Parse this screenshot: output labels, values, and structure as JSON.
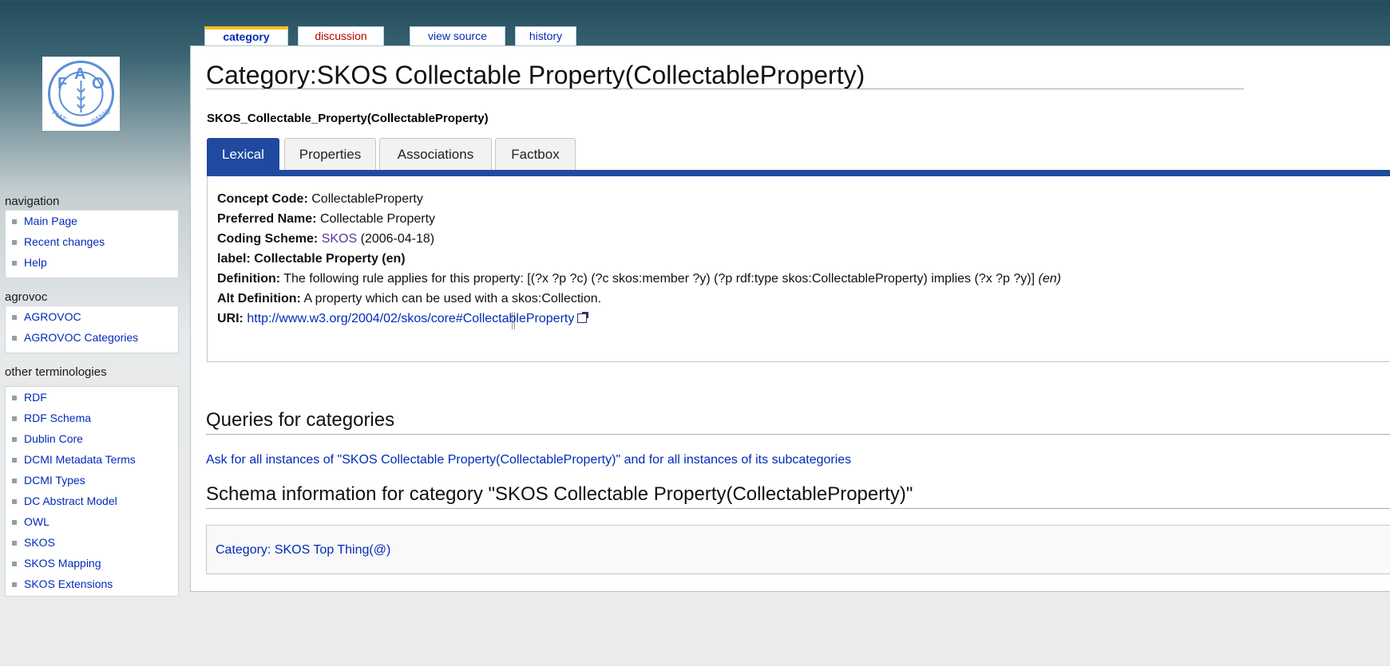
{
  "page_tabs": {
    "category": "category",
    "discussion": "discussion",
    "view_source": "view source",
    "history": "history"
  },
  "logo": {
    "alt": "FAO FIAT PANIS"
  },
  "sidebar": {
    "navigation": {
      "title": "navigation",
      "items": [
        "Main Page",
        "Recent changes",
        "Help"
      ]
    },
    "agrovoc": {
      "title": "agrovoc",
      "items": [
        "AGROVOC",
        "AGROVOC Categories"
      ]
    },
    "other": {
      "title": "other terminologies",
      "items": [
        "RDF",
        "RDF Schema",
        "Dublin Core",
        "DCMI Metadata Terms",
        "DCMI Types",
        "DC Abstract Model",
        "OWL",
        "SKOS",
        "SKOS Mapping",
        "SKOS Extensions"
      ]
    }
  },
  "main": {
    "title": "Category:SKOS Collectable Property(CollectableProperty)",
    "subheading": "SKOS_Collectable_Property(CollectableProperty)",
    "tabs": [
      "Lexical",
      "Properties",
      "Associations",
      "Factbox"
    ],
    "lexical": {
      "concept_code_label": "Concept Code:",
      "concept_code_value": "CollectableProperty",
      "preferred_name_label": "Preferred Name:",
      "preferred_name_value": "Collectable Property",
      "coding_scheme_label": "Coding Scheme:",
      "coding_scheme_link": "SKOS",
      "coding_scheme_date": "(2006-04-18)",
      "label_label": "label:",
      "label_value": "Collectable Property (en)",
      "definition_label": "Definition:",
      "definition_value": "The following rule applies for this property: [(?x ?p ?c) (?c skos:member ?y) (?p rdf:type skos:CollectableProperty) implies (?x ?p ?y)]",
      "definition_lang": "(en)",
      "alt_definition_label": "Alt Definition:",
      "alt_definition_value": "A property which can be used with a skos:Collection.",
      "uri_label": "URI:",
      "uri_value": "http://www.w3.org/2004/02/skos/core#CollectableProperty"
    },
    "queries_heading": "Queries for categories",
    "ask_link": "Ask for all instances of \"SKOS Collectable Property(CollectableProperty)\" and for all instances of its subcategories",
    "schema_heading": "Schema information for category \"SKOS Collectable Property(CollectableProperty)\"",
    "schema_category": "Category: SKOS Top Thing(@)"
  },
  "colors": {
    "tab_active": "#1f4aa0",
    "link": "#002bb8",
    "link_new": "#ba0000",
    "selected_tab_accent": "#fabd23"
  }
}
